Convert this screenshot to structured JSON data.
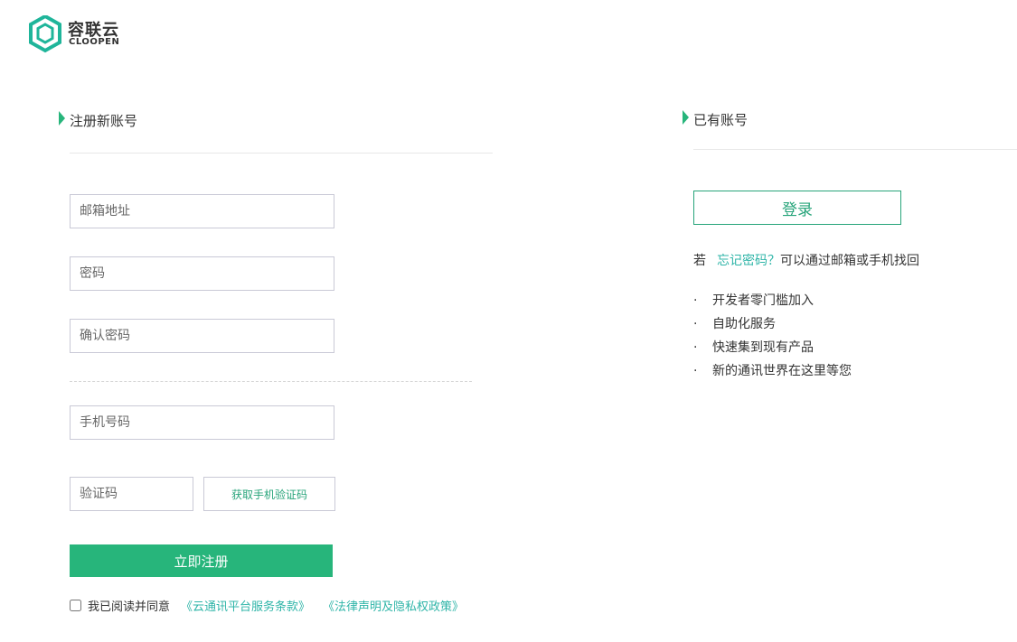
{
  "brand": {
    "name_cn": "容联云",
    "name_en": "CLOOPEN",
    "colors": {
      "primary": "#27b57b",
      "link": "#2fb5a8",
      "border": "#c9c9d6"
    }
  },
  "register": {
    "title": "注册新账号",
    "email_placeholder": "邮箱地址",
    "password_placeholder": "密码",
    "confirm_placeholder": "确认密码",
    "phone_placeholder": "手机号码",
    "code_placeholder": "验证码",
    "get_code_label": "获取手机验证码",
    "submit_label": "立即注册",
    "agree_text": "我已阅读并同意",
    "terms_link": "《云通讯平台服务条款》",
    "privacy_link": "《法律声明及隐私权政策》"
  },
  "login": {
    "title": "已有账号",
    "button_label": "登录",
    "forgot_prefix": "若",
    "forgot_link": "忘记密码？",
    "forgot_suffix": "可以通过邮箱或手机找回",
    "features": [
      "开发者零门槛加入",
      "自助化服务",
      "快速集到现有产品",
      "新的通讯世界在这里等您"
    ]
  }
}
